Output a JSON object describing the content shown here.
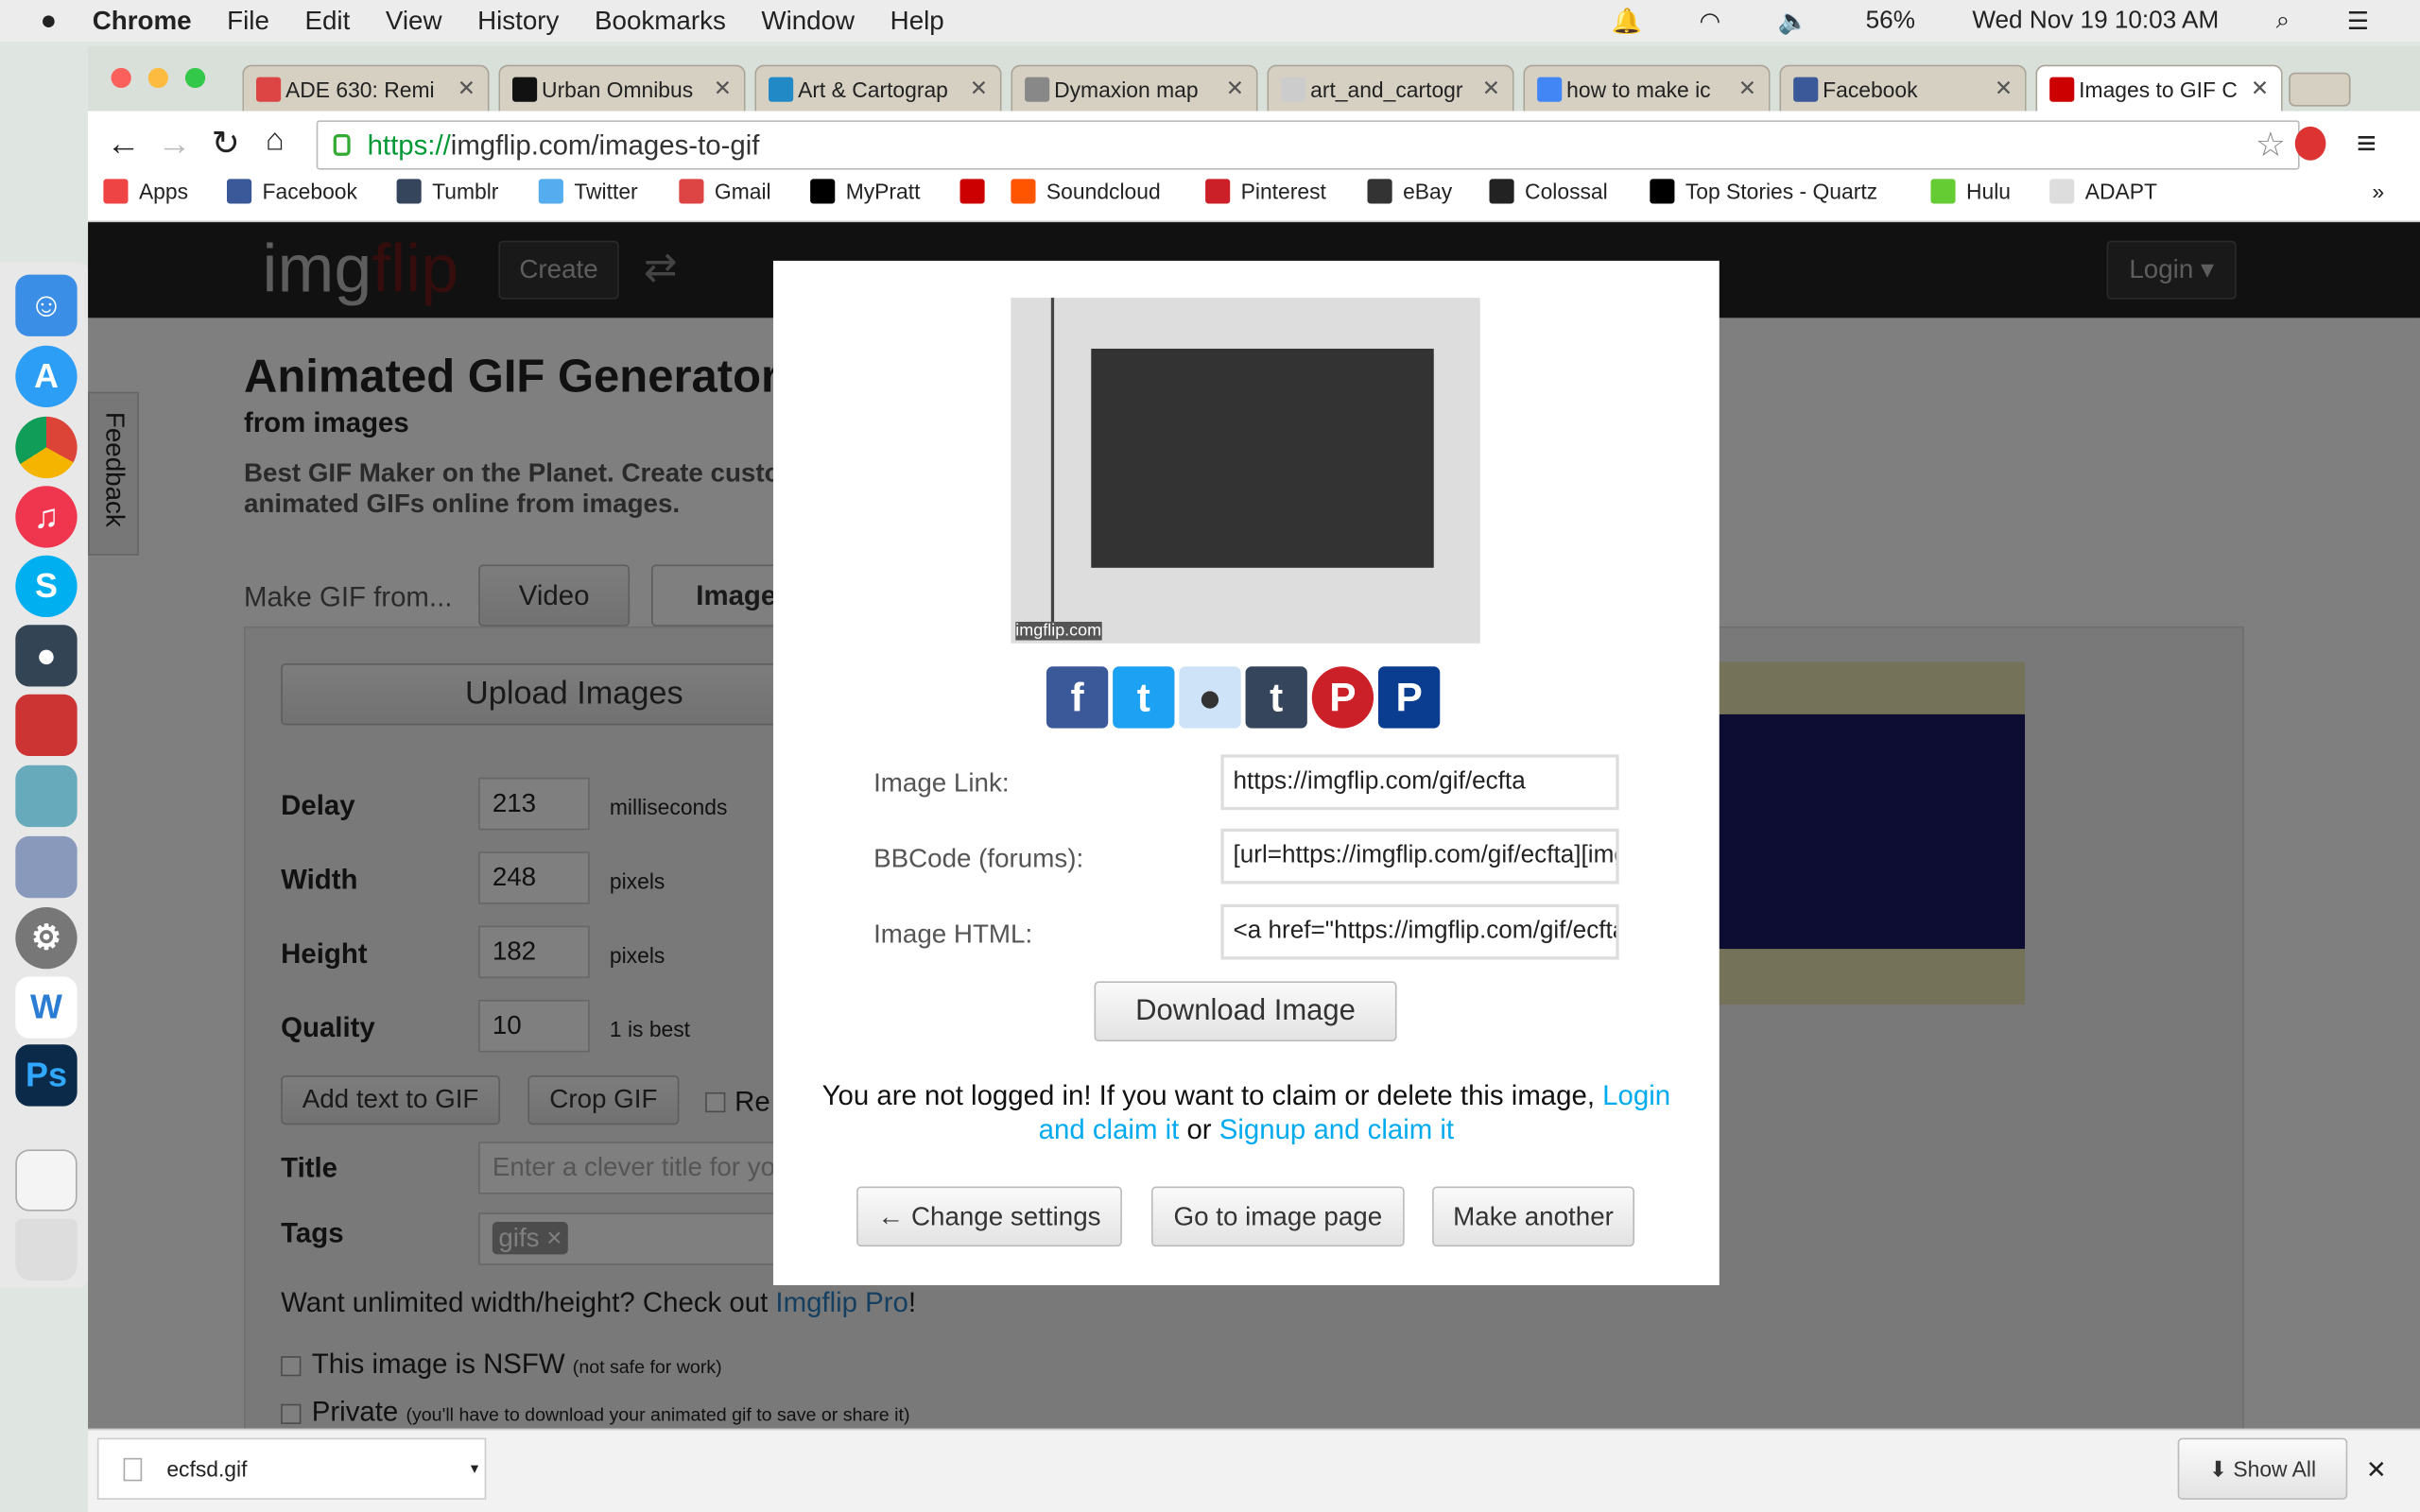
{
  "menubar": {
    "app": "Chrome",
    "items": [
      "File",
      "Edit",
      "View",
      "History",
      "Bookmarks",
      "Window",
      "Help"
    ],
    "battery": "56%",
    "datetime": "Wed Nov 19  10:03 AM"
  },
  "tabs": [
    {
      "label": "ADE 630: Remi",
      "icon": "gmail-icon",
      "color": "#d44"
    },
    {
      "label": "Urban Omnibus",
      "icon": "uo-icon",
      "color": "#111"
    },
    {
      "label": "Art & Cartograp",
      "icon": "wordpress-icon",
      "color": "#2189c5"
    },
    {
      "label": "Dymaxion map",
      "icon": "wikipedia-icon",
      "color": "#888"
    },
    {
      "label": "art_and_cartogr",
      "icon": "page-icon",
      "color": "#ccc"
    },
    {
      "label": "how to make ic",
      "icon": "google-icon",
      "color": "#4285f4"
    },
    {
      "label": "Facebook",
      "icon": "facebook-icon",
      "color": "#3b5998"
    },
    {
      "label": "Images to GIF C",
      "icon": "imgflip-icon",
      "color": "#c00"
    }
  ],
  "address": {
    "scheme": "https://",
    "rest": "imgflip.com/images-to-gif"
  },
  "bookmarks": [
    {
      "label": "Apps",
      "color": "#e44"
    },
    {
      "label": "Facebook",
      "color": "#3b5998"
    },
    {
      "label": "Tumblr",
      "color": "#35465c"
    },
    {
      "label": "Twitter",
      "color": "#55acee"
    },
    {
      "label": "Gmail",
      "color": "#d44"
    },
    {
      "label": "MyPratt",
      "color": "#000"
    },
    {
      "label": "",
      "color": "#c00"
    },
    {
      "label": "Soundcloud",
      "color": "#f50"
    },
    {
      "label": "Pinterest",
      "color": "#cb2027"
    },
    {
      "label": "eBay",
      "color": "#333"
    },
    {
      "label": "Colossal",
      "color": "#222"
    },
    {
      "label": "Top Stories - Quartz",
      "color": "#000"
    },
    {
      "label": "Hulu",
      "color": "#6c3"
    },
    {
      "label": "ADAPT",
      "color": "#ddd"
    }
  ],
  "site": {
    "logo_a": "img",
    "logo_b": "flip",
    "create": "Create",
    "login": "Login ▾",
    "feedback": "Feedback",
    "title": "Animated GIF Generator",
    "subtitle": "from images",
    "desc1": "Best GIF Maker on the Planet. Create custom",
    "desc2": "animated GIFs online from images.",
    "make_from": "Make GIF from...",
    "tab_video": "Video",
    "tab_images": "Images",
    "upload": "Upload Images",
    "fields": [
      {
        "label": "Delay",
        "value": "213",
        "unit": "milliseconds"
      },
      {
        "label": "Width",
        "value": "248",
        "unit": "pixels"
      },
      {
        "label": "Height",
        "value": "182",
        "unit": "pixels"
      },
      {
        "label": "Quality",
        "value": "10",
        "unit": "1 is best"
      }
    ],
    "add_text": "Add text to GIF",
    "crop": "Crop GIF",
    "reverse": "Re",
    "title_label": "Title",
    "title_placeholder": "Enter a clever title for yo",
    "tags_label": "Tags",
    "tag": "gifs ×",
    "pro_text": "Want unlimited width/height? Check out ",
    "pro_link": "Imgflip Pro",
    "pro_end": "!",
    "nsfw": "This image is NSFW",
    "nsfw_note": "(not safe for work)",
    "private": "Private",
    "private_note": "(you'll have to download your animated gif to save or share it)"
  },
  "modal": {
    "watermark": "imgflip.com",
    "rows": [
      {
        "label": "Image Link:",
        "value": "https://imgflip.com/gif/ecfta"
      },
      {
        "label": "BBCode (forums):",
        "value": "[url=https://imgflip.com/gif/ecfta][img"
      },
      {
        "label": "Image HTML:",
        "value": "<a href=\"https://imgflip.com/gif/ecfta"
      }
    ],
    "download": "Download Image",
    "notice": "You are not logged in! If you want to claim or delete this image, ",
    "login_link": "Login and claim it",
    "or": " or ",
    "signup_link": "Signup and claim it",
    "change": "← Change settings",
    "goto": "Go to image page",
    "another": "Make another"
  },
  "downloads": {
    "file": "ecfsd.gif",
    "show_all": "Show All"
  }
}
